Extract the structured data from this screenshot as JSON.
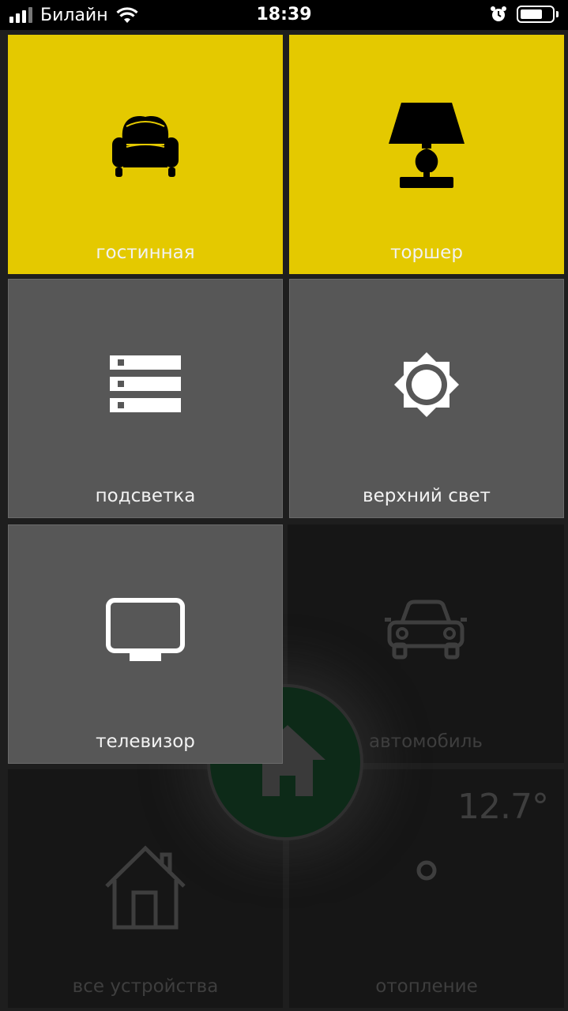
{
  "status_bar": {
    "carrier": "Билайн",
    "time": "18:39",
    "icons": [
      "signal-icon",
      "wifi-icon",
      "alarm-icon",
      "battery-icon"
    ],
    "battery_level": 0.7
  },
  "home_button": {
    "icon": "home-icon",
    "color": "#0d2a18"
  },
  "tiles": [
    {
      "label": "гостинная",
      "icon": "armchair-icon",
      "state": "on",
      "color": "#e4c900"
    },
    {
      "label": "торшер",
      "icon": "floor-lamp-icon",
      "state": "on",
      "color": "#e4c900"
    },
    {
      "label": "подсветка",
      "icon": "led-strip-icon",
      "state": "off",
      "color": "#575757"
    },
    {
      "label": "верхний свет",
      "icon": "ceiling-light-icon",
      "state": "off",
      "color": "#575757"
    },
    {
      "label": "телевизор",
      "icon": "tv-icon",
      "state": "off",
      "color": "#575757"
    },
    {
      "label": "автомобиль",
      "icon": "car-icon",
      "state": "inactive",
      "color": "#161616"
    },
    {
      "label": "все устройства",
      "icon": "house-outline-icon",
      "state": "inactive",
      "color": "#161616"
    },
    {
      "label": "отопление",
      "icon": "thermostat-icon",
      "state": "inactive",
      "color": "#161616",
      "value": "12.7°"
    }
  ]
}
